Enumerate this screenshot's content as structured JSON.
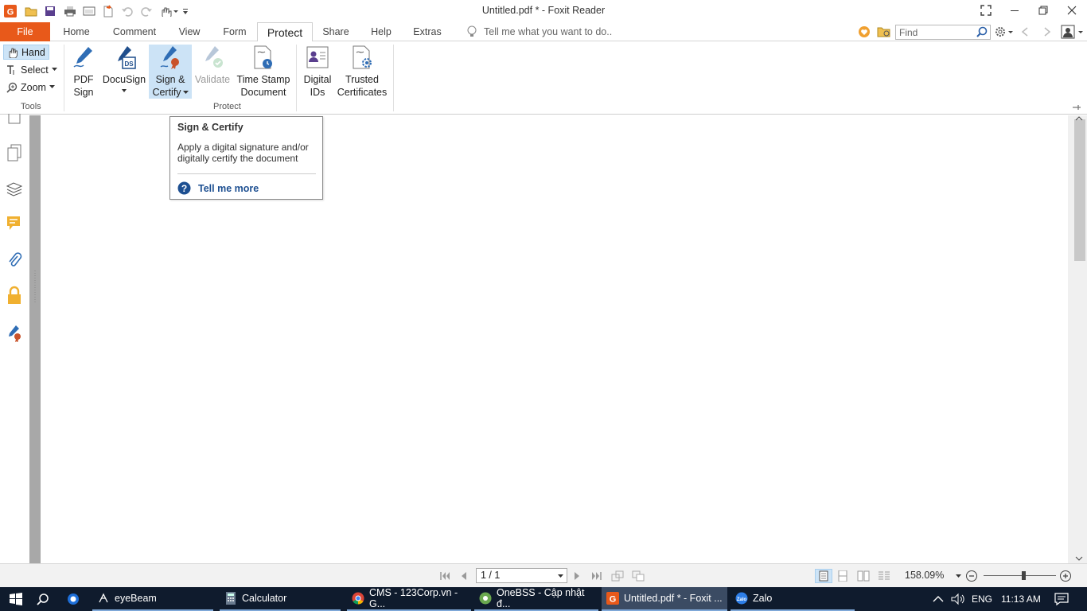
{
  "window": {
    "title": "Untitled.pdf * - Foxit Reader"
  },
  "tabs": {
    "file": "File",
    "home": "Home",
    "comment": "Comment",
    "view": "View",
    "form": "Form",
    "protect": "Protect",
    "share": "Share",
    "help": "Help",
    "extras": "Extras"
  },
  "tell_me": "Tell me what you want to do..",
  "find": {
    "placeholder": "Find"
  },
  "tools": {
    "hand": "Hand",
    "select": "Select",
    "zoom": "Zoom",
    "group": "Tools"
  },
  "protect": {
    "pdf_sign": [
      "PDF",
      "Sign"
    ],
    "docusign": "DocuSign",
    "sign_certify": [
      "Sign &",
      "Certify"
    ],
    "validate": "Validate",
    "timestamp": [
      "Time Stamp",
      "Document"
    ],
    "digital_ids": [
      "Digital",
      "IDs"
    ],
    "trusted_certs": [
      "Trusted",
      "Certificates"
    ],
    "group": "Protect"
  },
  "tooltip": {
    "title": "Sign & Certify",
    "description": "Apply a digital signature and/or digitally certify the document",
    "link": "Tell me more"
  },
  "status": {
    "page": "1 / 1",
    "zoom": "158.09%"
  },
  "taskbar": {
    "items": [
      "eyeBeam",
      "Calculator",
      "CMS - 123Corp.vn - G...",
      "OneBSS - Cập nhật đ...",
      "Untitled.pdf * - Foxit ...",
      "Zalo"
    ],
    "lang": "ENG",
    "time": "11:13 AM"
  },
  "colors": {
    "accent": "#e8591a",
    "taskbar": "#0f1b2d",
    "link": "#1d4f91"
  }
}
